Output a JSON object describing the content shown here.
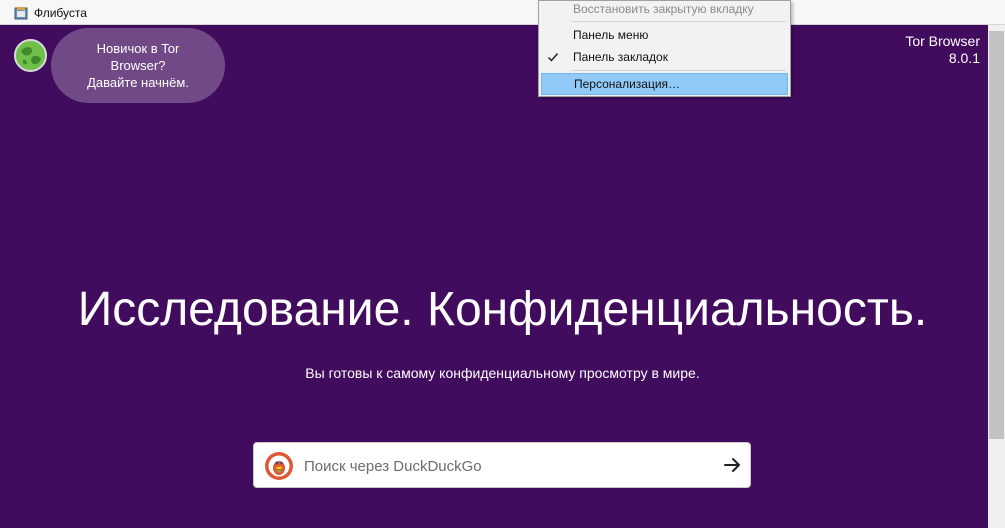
{
  "bookmarks_bar": {
    "items": [
      {
        "label": "Флибуста",
        "icon": "book-favicon-icon"
      }
    ]
  },
  "page": {
    "onboarding_bubble": {
      "line1": "Новичок в Tor",
      "line2": "Browser?",
      "line3": "Давайте начнём."
    },
    "version": {
      "product": "Tor Browser",
      "number": "8.0.1"
    },
    "hero": {
      "title": "Исследование. Конфиденциальность.",
      "subtitle": "Вы готовы к самому конфиденциальному просмотру в мире."
    },
    "search": {
      "placeholder": "Поиск через DuckDuckGo",
      "value": "",
      "engine_icon": "duckduckgo-icon",
      "submit_icon": "arrow-right-icon"
    },
    "colors": {
      "background": "#420c5e",
      "menu_highlight": "#91c9f7"
    }
  },
  "context_menu": {
    "items": [
      {
        "label": "Восстановить закрытую вкладку",
        "disabled": true,
        "checked": false,
        "highlighted": false
      },
      {
        "label": "Панель меню",
        "disabled": false,
        "checked": false,
        "highlighted": false
      },
      {
        "label": "Панель закладок",
        "disabled": false,
        "checked": true,
        "highlighted": false
      },
      {
        "label": "Персонализация…",
        "disabled": false,
        "checked": false,
        "highlighted": true
      }
    ]
  }
}
